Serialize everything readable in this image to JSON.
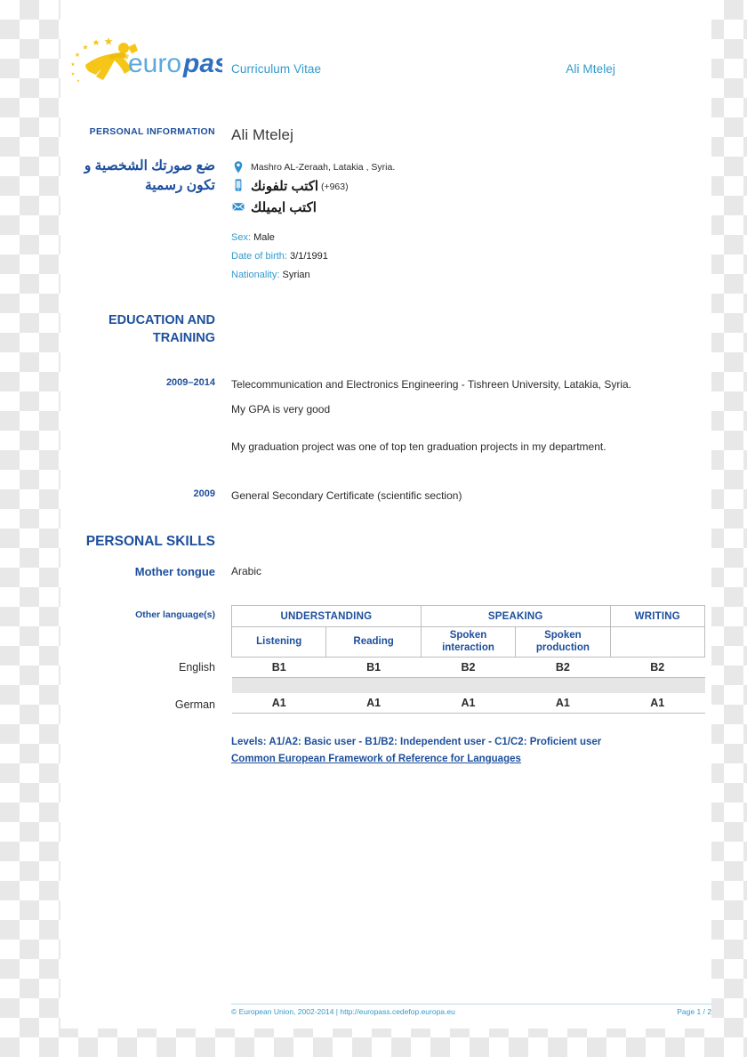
{
  "document": {
    "logo_text_light": "euro",
    "logo_text_bold": "pass",
    "cv_label": "Curriculum Vitae",
    "cv_header_name": "Ali Mtelej"
  },
  "personal_information": {
    "section_label": "PERSONAL INFORMATION",
    "photo_note_arabic": "ضع صورتك الشخصية و تكون رسمية",
    "name": "Ali Mtelej",
    "address": "Mashro AL-Zeraah, Latakia , Syria.",
    "address_icon": "location-pin-icon",
    "phone_prefix": "(+963)",
    "phone_arabic": "اكتب تلفونك",
    "phone_icon": "mobile-phone-icon",
    "email_arabic": "اكتب ايميلك",
    "email_icon": "envelope-icon",
    "fields": [
      {
        "key": "Sex:",
        "value": "Male"
      },
      {
        "key": "Date of birth:",
        "value": "3/1/1991"
      },
      {
        "key": "Nationality:",
        "value": "Syrian"
      }
    ]
  },
  "education": {
    "section_label": "EDUCATION AND TRAINING",
    "entries": [
      {
        "period": "2009–2014",
        "lines": [
          "Telecommunication and Electronics Engineering - Tishreen University, Latakia, Syria.",
          "My GPA is very good",
          "My graduation project was one of top ten graduation projects in my department."
        ]
      },
      {
        "period": "2009",
        "lines": [
          "General Secondary Certificate (scientific section)"
        ]
      }
    ]
  },
  "personal_skills": {
    "section_label": "PERSONAL SKILLS",
    "mother_tongue_label": "Mother tongue",
    "mother_tongue_value": "Arabic",
    "other_languages_label": "Other language(s)",
    "table": {
      "group_headers": [
        "UNDERSTANDING",
        "SPEAKING",
        "WRITING"
      ],
      "sub_headers": [
        "Listening",
        "Reading",
        "Spoken interaction",
        "Spoken production",
        ""
      ],
      "sub_headers_split": [
        [
          "Listening",
          ""
        ],
        [
          "Reading",
          ""
        ],
        [
          "Spoken",
          "interaction"
        ],
        [
          "Spoken",
          "production"
        ],
        [
          "",
          ""
        ]
      ],
      "rows": [
        {
          "language": "English",
          "levels": [
            "B1",
            "B1",
            "B2",
            "B2",
            "B2"
          ]
        },
        {
          "language": "German",
          "levels": [
            "A1",
            "A1",
            "A1",
            "A1",
            "A1"
          ]
        }
      ]
    },
    "levels_note": "Levels: A1/A2: Basic user - B1/B2: Independent user - C1/C2: Proficient user",
    "levels_link": "Common European Framework of Reference for Languages"
  },
  "footer": {
    "copyright": "© European Union, 2002-2014 | http://europass.cedefop.europa.eu",
    "page": "Page 1 / 2"
  },
  "colors": {
    "accent_blue": "#1d4f9c",
    "light_blue": "#3399cc",
    "logo_yellow": "#f2c80f",
    "table_border": "#bdbdbd",
    "spacer_gray": "#e6e6e6"
  }
}
